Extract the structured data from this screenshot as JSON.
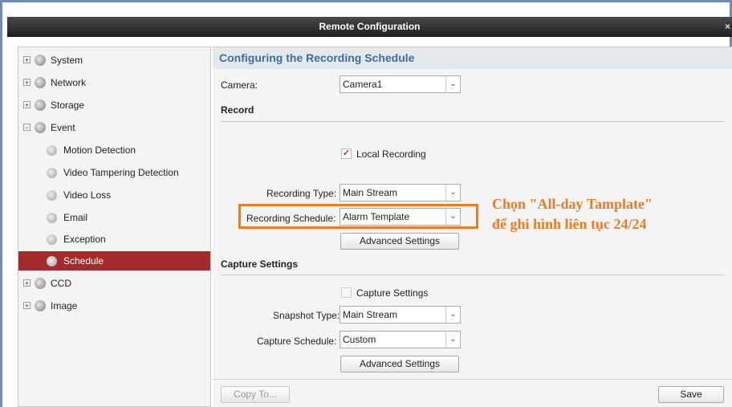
{
  "window": {
    "title": "Remote Configuration",
    "close_glyph": "×"
  },
  "sidebar": {
    "top": [
      {
        "label": "System",
        "expander": "+"
      },
      {
        "label": "Network",
        "expander": "+"
      },
      {
        "label": "Storage",
        "expander": "+"
      },
      {
        "label": "Event",
        "expander": "−"
      }
    ],
    "event_children": [
      {
        "label": "Motion Detection"
      },
      {
        "label": "Video Tampering Detection"
      },
      {
        "label": "Video Loss"
      },
      {
        "label": "Email"
      },
      {
        "label": "Exception"
      },
      {
        "label": "Schedule"
      }
    ],
    "bottom": [
      {
        "label": "CCD",
        "expander": "+"
      },
      {
        "label": "Image",
        "expander": "+"
      }
    ],
    "selected_color": "#a42b2b"
  },
  "main": {
    "heading": "Configuring the Recording Schedule",
    "camera": {
      "label": "Camera:",
      "value": "Camera1"
    },
    "record": {
      "section": "Record",
      "local_recording": {
        "label": "Local Recording",
        "checked": true,
        "mark": "✓"
      },
      "recording_type": {
        "label": "Recording Type:",
        "value": "Main Stream"
      },
      "recording_schedule": {
        "label": "Recording Schedule:",
        "value": "Alarm Template"
      },
      "advanced_button": "Advanced Settings"
    },
    "capture": {
      "section": "Capture Settings",
      "capture_checkbox": {
        "label": "Capture Settings",
        "checked": false
      },
      "snapshot_type": {
        "label": "Snapshot Type:",
        "value": "Main Stream"
      },
      "capture_schedule": {
        "label": "Capture Schedule:",
        "value": "Custom"
      },
      "advanced_button": "Advanced Settings"
    },
    "footer": {
      "copy_to": "Copy To...",
      "save": "Save"
    },
    "dropdown_arrow": "⌄"
  },
  "annotation": {
    "line1": "Chọn \"All-day Tamplate\"",
    "line2": "để ghi hình liên tục 24/24",
    "color": "#ee7a22"
  }
}
